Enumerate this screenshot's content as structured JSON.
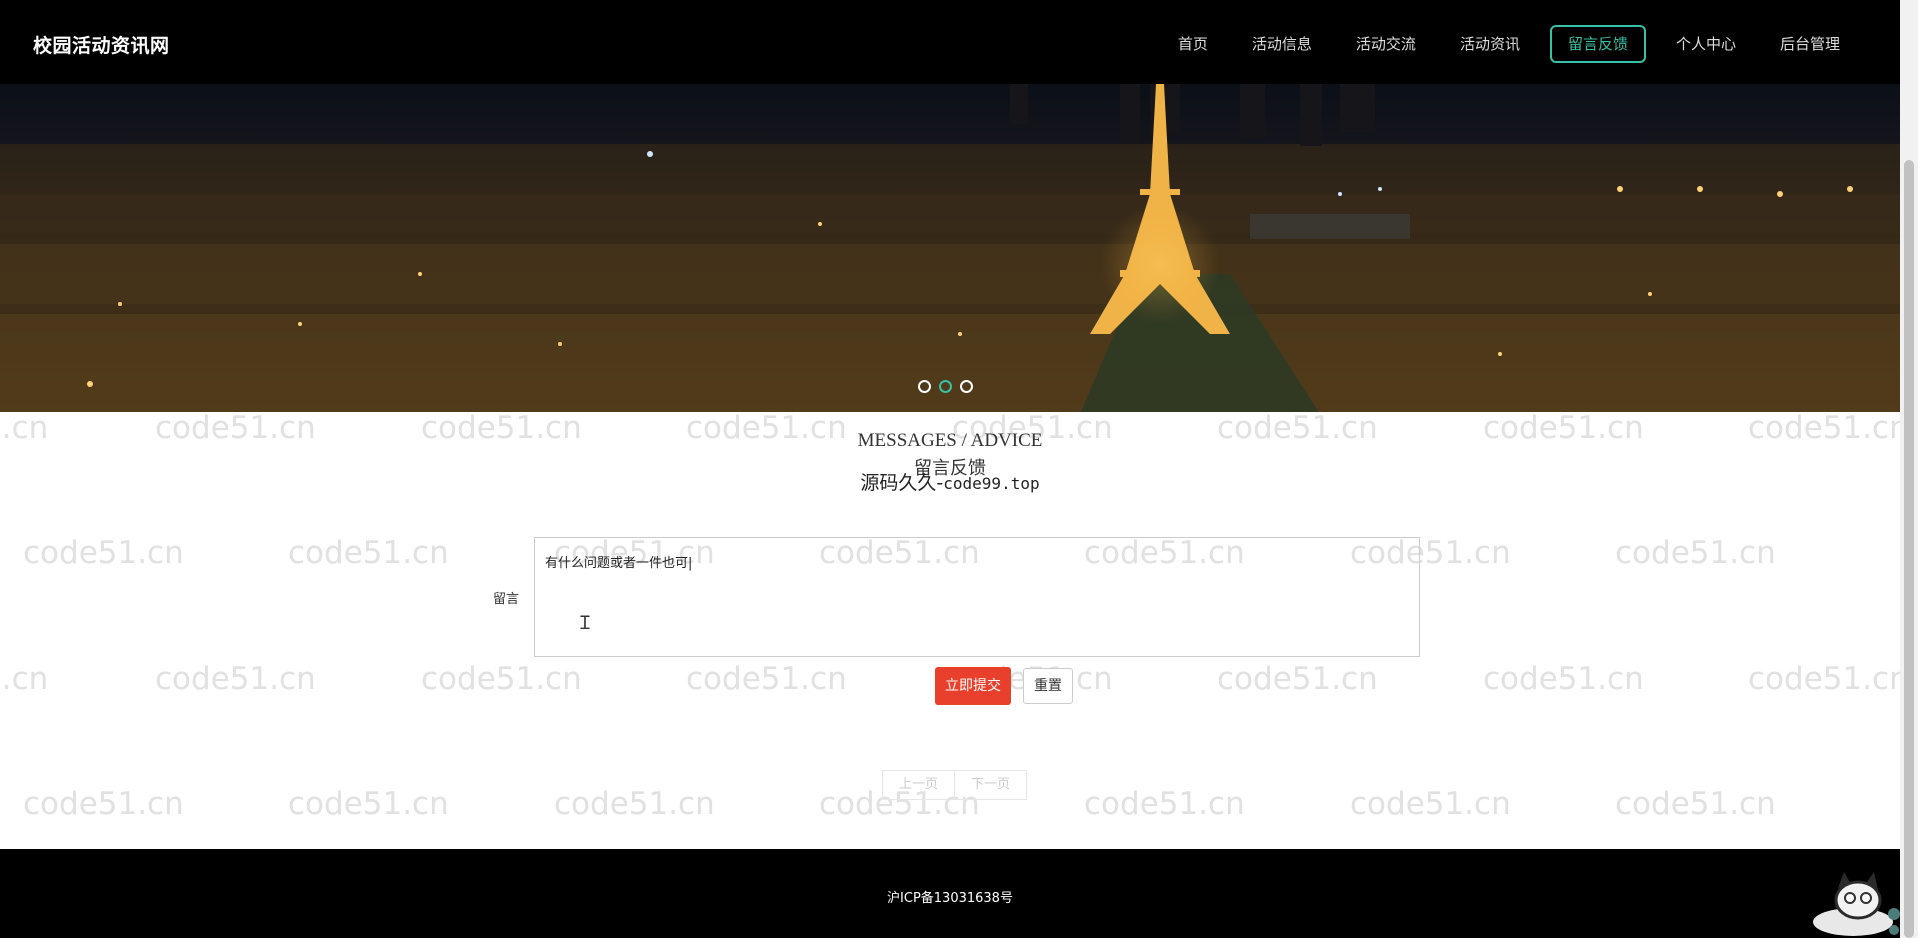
{
  "nav": {
    "brand": "校园活动资讯网",
    "items": [
      {
        "label": "首页",
        "active": false
      },
      {
        "label": "活动信息",
        "active": false
      },
      {
        "label": "活动交流",
        "active": false
      },
      {
        "label": "活动资讯",
        "active": false
      },
      {
        "label": "留言反馈",
        "active": true
      },
      {
        "label": "个人中心",
        "active": false
      },
      {
        "label": "后台管理",
        "active": false
      }
    ],
    "accent_color": "#37c1a5"
  },
  "banner": {
    "slide_count": 3,
    "active_slide": 2
  },
  "watermark": "code51.cn",
  "section": {
    "title_en": "MESSAGES / ADVICE",
    "title_cn": "留言反馈",
    "source_prefix": "源码久久-",
    "source_suffix": "code99.top"
  },
  "form": {
    "label": "留言",
    "value": "有什么问题或者一件也可|",
    "submit_label": "立即提交",
    "reset_label": "重置",
    "submit_color": "#e8402d"
  },
  "pager": {
    "prev": "上一页",
    "next": "下一页"
  },
  "footer": {
    "icp": "沪ICP备13031638号"
  }
}
